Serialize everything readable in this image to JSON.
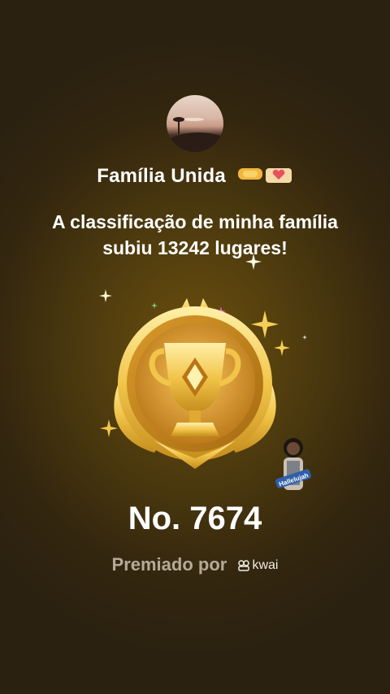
{
  "family": {
    "name": "Família Unida",
    "emoji": "🤝🫶"
  },
  "message": "A classificação de minha família subiu 13242 lugares!",
  "rank": {
    "label": "No. 7674"
  },
  "sticker_text": "Hallelujah",
  "award": {
    "label": "Premiado por",
    "brand": "kwai"
  },
  "colors": {
    "gold": "#f2c54a",
    "gold_dark": "#b9821a",
    "muted_text": "#b4aa97"
  }
}
